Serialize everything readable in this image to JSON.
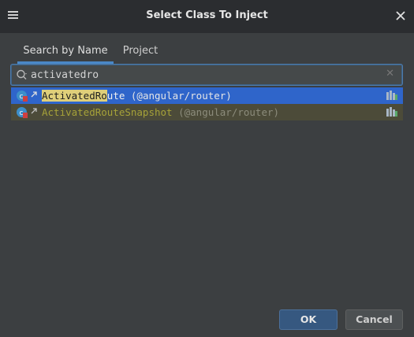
{
  "dialog": {
    "title": "Select Class To Inject"
  },
  "tabs": [
    {
      "label": "Search by Name",
      "active": true
    },
    {
      "label": "Project",
      "active": false
    }
  ],
  "search": {
    "value": "activatedro",
    "clear_icon": "close-small-icon",
    "icon": "search-icon"
  },
  "results": [
    {
      "match": "ActivatedRo",
      "rest": "ute",
      "location": " (@angular/router)",
      "selected": true,
      "icon": "angular-class-icon"
    },
    {
      "match": "",
      "rest": "ActivatedRouteSnapshot",
      "location": " (@angular/router)",
      "selected": false,
      "icon": "angular-class-icon"
    }
  ],
  "buttons": {
    "ok_label": "OK",
    "cancel_label": "Cancel"
  },
  "colors": {
    "accent": "#4a88c7",
    "selection": "#2f65ca",
    "match_highlight": "#dfcf7a",
    "background": "#3c3f41"
  }
}
